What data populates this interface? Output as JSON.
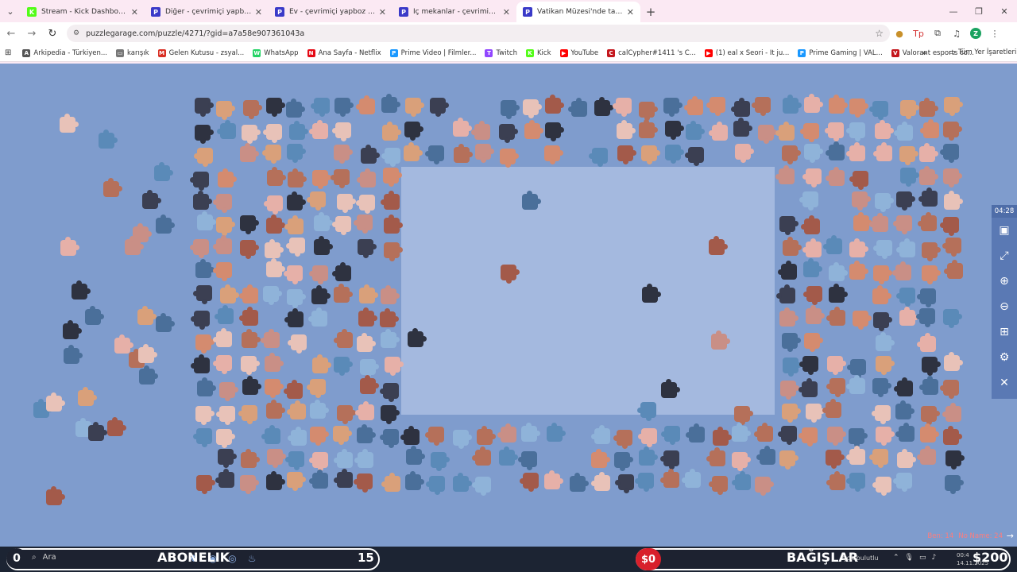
{
  "browser": {
    "tabs": [
      {
        "label": "Stream - Kick Dashboard",
        "favicon_color": "#53fc18",
        "glyph": "K",
        "active": false
      },
      {
        "label": "Diğer - çevrimiçi yapboz koleks",
        "favicon_color": "#3a3ac8",
        "glyph": "P",
        "active": false
      },
      {
        "label": "Ev - çevrimiçi yapboz koleksiyo",
        "favicon_color": "#3a3ac8",
        "glyph": "P",
        "active": false
      },
      {
        "label": "İç mekanlar - çevrimiçi yapboz",
        "favicon_color": "#3a3ac8",
        "glyph": "P",
        "active": false
      },
      {
        "label": "Vatikan Müzesi'nde tavanda",
        "favicon_color": "#3a3ac8",
        "glyph": "P",
        "active": true
      }
    ],
    "url": "puzzlegarage.com/puzzle/4271/?gid=a7a58e907361043a",
    "profile_initial": "Z",
    "bookmarks": [
      {
        "label": "Arkipedia - Türkiyen...",
        "color": "#555555",
        "glyph": "A"
      },
      {
        "label": "karışık",
        "color": "#777777",
        "glyph": "▭"
      },
      {
        "label": "Gelen Kutusu - zsyal...",
        "color": "#d93025",
        "glyph": "M"
      },
      {
        "label": "WhatsApp",
        "color": "#25d366",
        "glyph": "W"
      },
      {
        "label": "Ana Sayfa - Netflix",
        "color": "#e50914",
        "glyph": "N"
      },
      {
        "label": "Prime Video | Filmler...",
        "color": "#1a98ff",
        "glyph": "P"
      },
      {
        "label": "Twitch",
        "color": "#9146ff",
        "glyph": "T"
      },
      {
        "label": "Kick",
        "color": "#53fc18",
        "glyph": "K"
      },
      {
        "label": "YouTube",
        "color": "#ff0000",
        "glyph": "▶"
      },
      {
        "label": "calCypher#1411 's C...",
        "color": "#c4161c",
        "glyph": "C"
      },
      {
        "label": "(1) eal x Seori - It ju...",
        "color": "#ff0000",
        "glyph": "▶"
      },
      {
        "label": "Prime Gaming | VAL...",
        "color": "#1a98ff",
        "glyph": "P"
      },
      {
        "label": "Valorant esports co...",
        "color": "#c4161c",
        "glyph": "V"
      }
    ],
    "all_bookmarks_label": "Tüm Yer İşaretleri"
  },
  "puzzle": {
    "timer": "04:28",
    "stats_label_1": "Ben: 14",
    "stats_label_2": "No Name: 24",
    "background_color": "#7f9ccd",
    "board_color": "#a4b9df"
  },
  "overlay": {
    "left_count": "0",
    "search_label": "Ara",
    "subscriptions_label": "ABONELIK",
    "subscriptions_count": "15",
    "donation_badge": "$0",
    "donations_label": "BAĞIŞLAR",
    "weather": "Çok bulutlu",
    "clock_time": "00:4",
    "clock_date": "14.11.2025",
    "donation_total": "$200"
  }
}
